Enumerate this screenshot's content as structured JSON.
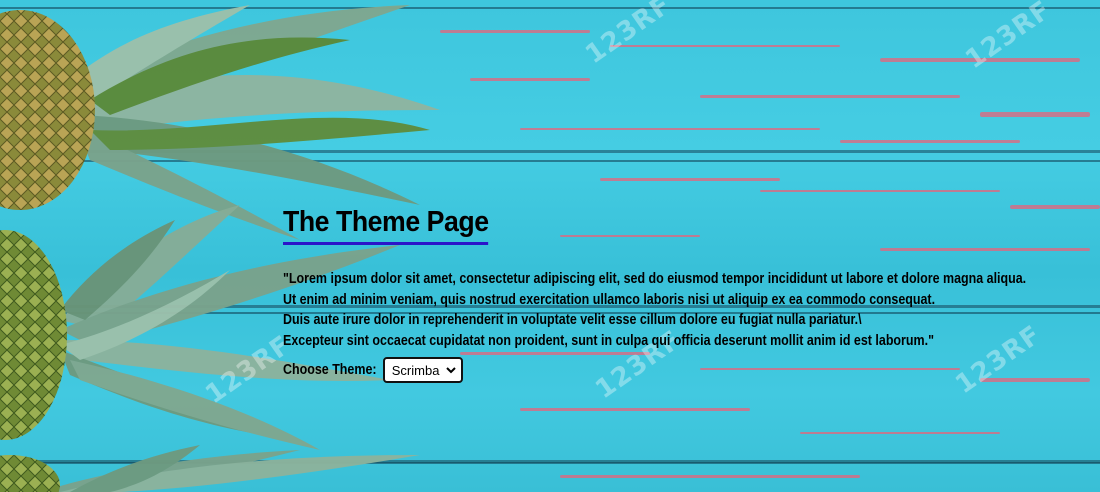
{
  "page": {
    "title": "The Theme Page",
    "paragraph_lines": [
      "\"Lorem ipsum dolor sit amet, consectetur adipiscing elit, sed do eiusmod tempor incididunt ut labore et dolore magna aliqua.",
      "Ut enim ad minim veniam, quis nostrud exercitation ullamco laboris nisi ut aliquip ex ea commodo consequat.",
      "Duis aute irure dolor in reprehenderit in voluptate velit esse cillum dolore eu fugiat nulla pariatur.\\",
      "Excepteur sint occaecat cupidatat non proident, sunt in culpa qui officia deserunt mollit anim id est laborum.\""
    ],
    "theme_label": "Choose Theme:",
    "theme_selected": "Scrimba",
    "watermark_text": "123RF"
  },
  "colors": {
    "title_underline": "#2b15c9",
    "background": "#42c9e0",
    "paint_streak": "#e8637a"
  },
  "icons": {
    "select_arrow": "chevron-down-icon",
    "background_image": "pineapple-image"
  }
}
